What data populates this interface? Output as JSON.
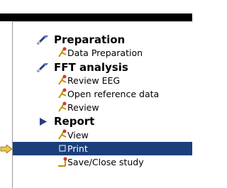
{
  "tree": {
    "groups": [
      {
        "label": "Preparation",
        "icon": "tools-icon",
        "items": [
          {
            "label": "Data Preparation",
            "icon": "pin-icon"
          }
        ]
      },
      {
        "label": "FFT analysis",
        "icon": "tools-icon",
        "items": [
          {
            "label": "Review EEG",
            "icon": "pin-icon"
          },
          {
            "label": "Open reference data",
            "icon": "pin-icon"
          },
          {
            "label": "Review",
            "icon": "pin-icon"
          }
        ]
      },
      {
        "label": "Report",
        "icon": "play-icon",
        "items": [
          {
            "label": "View",
            "icon": "pin-icon"
          },
          {
            "label": "Print",
            "icon": "checkbox-icon",
            "selected": true
          },
          {
            "label": "Save/Close study",
            "icon": "pin-icon"
          }
        ]
      }
    ]
  },
  "colors": {
    "selection": "#1a3f7a",
    "arrow": "#e8c84a",
    "pin_red": "#d23a2a",
    "pin_stem": "#d0a000"
  }
}
